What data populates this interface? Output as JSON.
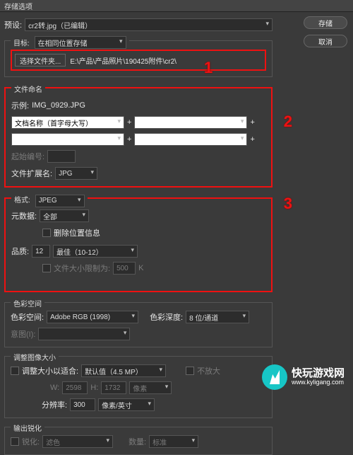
{
  "title": "存储选项",
  "buttons": {
    "save": "存储",
    "cancel": "取消"
  },
  "preset": {
    "label": "预设:",
    "value": "cr2转.jpg（已编辑）"
  },
  "target": {
    "legend": "目标:",
    "mode": "在相同位置存储",
    "choose_folder": "选择文件夹...",
    "path": "E:\\产品\\产品照片\\190425附件\\cr2\\"
  },
  "naming": {
    "legend": "文件命名",
    "example_label": "示例:",
    "example_value": "IMG_0929.JPG",
    "part1": "文档名称（首字母大写）",
    "part2": "",
    "part3": "",
    "part4": "",
    "plus": "+",
    "start_num_label": "起始编号:",
    "start_num": "",
    "ext_label": "文件扩展名:",
    "ext": "JPG"
  },
  "format": {
    "legend": "格式:",
    "value": "JPEG",
    "meta_label": "元数据:",
    "meta_value": "全部",
    "del_loc": "删除位置信息",
    "quality_label": "品质:",
    "quality_val": "12",
    "quality_preset": "最佳（10-12）",
    "limit_label": "文件大小限制为:",
    "limit_val": "500",
    "limit_unit": "K"
  },
  "colorspace": {
    "legend": "色彩空间",
    "space_label": "色彩空间:",
    "space": "Adobe RGB (1998)",
    "depth_label": "色彩深度:",
    "depth": "8 位/通道",
    "intent_label": "意图(I):",
    "intent": ""
  },
  "resize": {
    "legend": "调整图像大小",
    "fit_label": "调整大小以适合:",
    "fit": "默认值（4.5 MP）",
    "no_enlarge": "不放大",
    "w_label": "W:",
    "w": "2598",
    "h_label": "H:",
    "h": "1732",
    "unit": "像素",
    "res_label": "分辨率:",
    "res": "300",
    "res_unit": "像素/英寸"
  },
  "sharpen": {
    "legend": "输出锐化",
    "enable": "锐化:",
    "for": "滤色",
    "amount_label": "数量:",
    "amount": "标准"
  },
  "annot": {
    "a1": "1",
    "a2": "2",
    "a3": "3"
  },
  "watermark": {
    "line1": "快玩游戏网",
    "line2": "www.kyligang.com"
  }
}
